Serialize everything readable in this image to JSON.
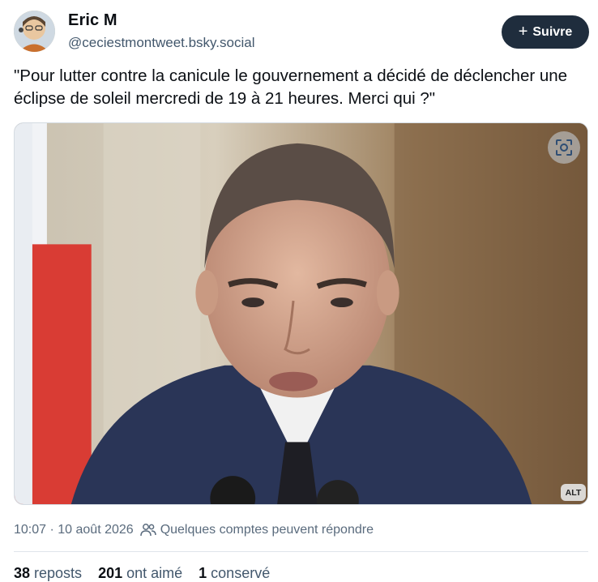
{
  "author": {
    "name": "Eric M",
    "handle": "@ceciestmontweet.bsky.social",
    "avatar_icon": "avatar-photo"
  },
  "follow_button": {
    "label": "Suivre",
    "icon": "plus-icon"
  },
  "post": {
    "text": "\"Pour lutter contre la canicule le gouvernement a décidé de déclencher une éclipse de soleil mercredi de 19 à 21 heures. Merci qui ?\""
  },
  "image": {
    "alt_badge": "ALT",
    "zoom_icon": "scan-icon"
  },
  "meta": {
    "timestamp": "10:07 · 10 août 2026",
    "reply_setting": "Quelques comptes peuvent répondre",
    "reply_icon": "people-icon"
  },
  "stats": {
    "reposts_count": "38",
    "reposts_label": "reposts",
    "likes_count": "201",
    "likes_label": "ont aimé",
    "saves_count": "1",
    "saves_label": "conservé"
  },
  "colors": {
    "button_bg": "#1f2d3d",
    "muted_text": "#42576c",
    "divider": "#dfe5eb"
  }
}
